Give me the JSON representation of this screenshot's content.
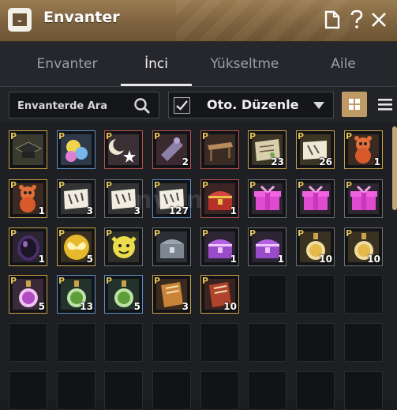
{
  "window": {
    "title": "Envanter",
    "icons": [
      "inventory-icon",
      "document-icon",
      "help-icon",
      "close-icon"
    ]
  },
  "tabs": [
    {
      "label": "Envanter",
      "active": false
    },
    {
      "label": "İnci",
      "active": true
    },
    {
      "label": "Yükseltme",
      "active": false
    },
    {
      "label": "Aile",
      "active": false
    }
  ],
  "toolbar": {
    "search_placeholder": "Envanterde Ara",
    "auto_sort_checked": true,
    "sort_label": "Oto. Düzenle",
    "view_modes": [
      "grid-view",
      "list-view"
    ]
  },
  "colors": {
    "title_bar": "#8a6d47",
    "accent": "#c09a66",
    "badge_p": "#e2c35e",
    "border_gold": "#c9a24a",
    "border_blue": "#5d8fc7",
    "border_red": "#b8524f",
    "border_gray": "#6c6e72"
  },
  "items": [
    {
      "name": "mortarboard-box",
      "count": "",
      "premium": true,
      "border": "gold"
    },
    {
      "name": "chick-egg",
      "count": "",
      "premium": true,
      "border": "blue"
    },
    {
      "name": "moon-star",
      "count": "",
      "premium": true,
      "border": "red"
    },
    {
      "name": "scroll",
      "count": "2",
      "premium": true,
      "border": "red"
    },
    {
      "name": "wooden-table",
      "count": "",
      "premium": true,
      "border": "red"
    },
    {
      "name": "scroll-map",
      "count": "23",
      "premium": true,
      "border": "gold"
    },
    {
      "name": "ticket",
      "count": "26",
      "premium": true,
      "border": "gold"
    },
    {
      "name": "bear-figure",
      "count": "1",
      "premium": true,
      "border": "gold"
    },
    {
      "name": "bear-figure",
      "count": "1",
      "premium": true,
      "border": "gold"
    },
    {
      "name": "coupon",
      "count": "3",
      "premium": true,
      "border": "gray"
    },
    {
      "name": "coupon",
      "count": "3",
      "premium": true,
      "border": "gray"
    },
    {
      "name": "coupon",
      "count": "127",
      "premium": true,
      "border": "blue"
    },
    {
      "name": "red-chest",
      "count": "1",
      "premium": true,
      "border": "red"
    },
    {
      "name": "pink-gift",
      "count": "",
      "premium": true,
      "border": "gray"
    },
    {
      "name": "pink-gift",
      "count": "",
      "premium": true,
      "border": "gray"
    },
    {
      "name": "pink-gift",
      "count": "",
      "premium": true,
      "border": "gray"
    },
    {
      "name": "black-egg",
      "count": "1",
      "premium": true,
      "border": "gold"
    },
    {
      "name": "butterfly-coin",
      "count": "5",
      "premium": true,
      "border": "gold"
    },
    {
      "name": "yellow-face",
      "count": "",
      "premium": true,
      "border": "gray"
    },
    {
      "name": "silver-chest",
      "count": "",
      "premium": true,
      "border": "gray"
    },
    {
      "name": "purple-chest",
      "count": "1",
      "premium": true,
      "border": "gray"
    },
    {
      "name": "purple-chest",
      "count": "1",
      "premium": true,
      "border": "gray"
    },
    {
      "name": "gold-potion",
      "count": "10",
      "premium": true,
      "border": "gray"
    },
    {
      "name": "gold-potion",
      "count": "10",
      "premium": true,
      "border": "gray"
    },
    {
      "name": "purple-potion",
      "count": "5",
      "premium": true,
      "border": "gold"
    },
    {
      "name": "green-potion",
      "count": "13",
      "premium": true,
      "border": "blue"
    },
    {
      "name": "green-potion",
      "count": "5",
      "premium": true,
      "border": "blue"
    },
    {
      "name": "book",
      "count": "3",
      "premium": true,
      "border": "gold"
    },
    {
      "name": "book-red",
      "count": "10",
      "premium": true,
      "border": "gold"
    }
  ],
  "badge_label": "P"
}
